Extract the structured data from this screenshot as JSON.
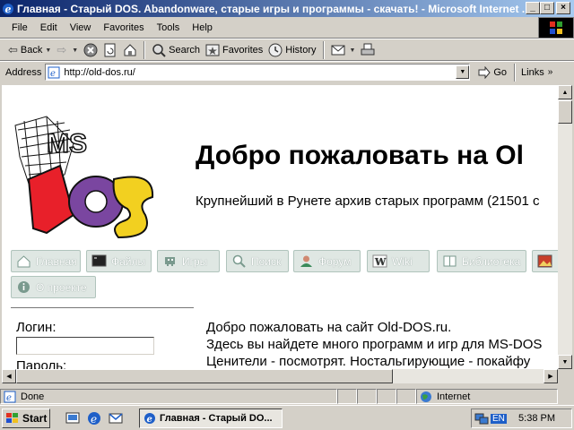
{
  "window": {
    "title": "Главная - Старый DOS. Abandonware, старые игры и программы - скачать! - Microsoft Internet ...",
    "controls": {
      "minimize": "_",
      "maximize": "□",
      "close": "×"
    }
  },
  "menu": [
    "File",
    "Edit",
    "View",
    "Favorites",
    "Tools",
    "Help"
  ],
  "toolbar": {
    "back": "Back",
    "forward": "⇨",
    "stop": "×",
    "search": "Search",
    "favorites": "Favorites",
    "history": "History"
  },
  "address": {
    "label": "Address",
    "url": "http://old-dos.ru/",
    "go": "Go",
    "links": "Links"
  },
  "page": {
    "logo_text": "MS DOS",
    "welcome": "Добро пожаловать на Ol",
    "subtitle": "Крупнейший в Рунете архив старых программ (21501 с",
    "nav": [
      {
        "label": "Главная",
        "icon": "home-icon"
      },
      {
        "label": "Файлы",
        "icon": "monitor-icon"
      },
      {
        "label": "Игры",
        "icon": "invader-icon"
      },
      {
        "label": "Поиск",
        "icon": "magnifier-icon"
      },
      {
        "label": "Форум",
        "icon": "user-icon"
      },
      {
        "label": "Wiki",
        "icon": "wiki-icon"
      },
      {
        "label": "Библиотека",
        "icon": "book-icon"
      },
      {
        "label": "",
        "icon": "picture-icon"
      },
      {
        "label": "О проекте",
        "icon": "info-icon"
      }
    ],
    "login_label": "Логин:",
    "password_label": "Пароль:",
    "main_lines": [
      "Добро пожаловать на сайт Old-DOS.ru.",
      "Здесь вы найдете много программ и игр для MS-DOS",
      "Ценители - посмотрят. Ностальгирующие - покайфу"
    ]
  },
  "status": {
    "text": "Done",
    "zone": "Internet"
  },
  "taskbar": {
    "start": "Start",
    "task": "Главная - Старый DO...",
    "lang": "EN",
    "clock": "5:38 PM"
  },
  "colors": {
    "title_start": "#0a246a",
    "title_end": "#a6caf0",
    "chrome": "#d4d0c8",
    "nav_button": "#dfe7e3"
  }
}
